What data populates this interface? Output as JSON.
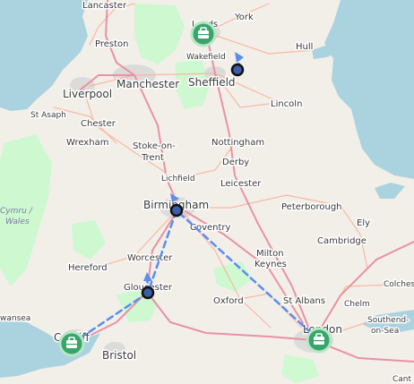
{
  "map": {
    "colors": {
      "sea": "#aad3df",
      "land": "#f2efe9",
      "road_major": "#e892a2",
      "road_primary": "#f9b29c",
      "park": "#c8facc",
      "urban": "#dddddd",
      "route": "#5b8def",
      "hub_fill": "#3aa56b",
      "stop_fill": "#3b5ea8"
    },
    "places": [
      {
        "name": "Lancaster",
        "size": "md"
      },
      {
        "name": "Leeds",
        "size": "md"
      },
      {
        "name": "York",
        "size": "md"
      },
      {
        "name": "Preston",
        "size": "md"
      },
      {
        "name": "Wakefield",
        "size": "sm"
      },
      {
        "name": "Hull",
        "size": "md"
      },
      {
        "name": "Liverpool",
        "size": "lg"
      },
      {
        "name": "Manchester",
        "size": "lg"
      },
      {
        "name": "Sheffield",
        "size": "lg"
      },
      {
        "name": "St Asaph",
        "size": "sm"
      },
      {
        "name": "Chester",
        "size": "md"
      },
      {
        "name": "Lincoln",
        "size": "md"
      },
      {
        "name": "Wrexham",
        "size": "md"
      },
      {
        "name": "Stoke-on-",
        "size": "md"
      },
      {
        "name": "Trent",
        "size": "md"
      },
      {
        "name": "Nottingham",
        "size": "md"
      },
      {
        "name": "Lichfield",
        "size": "sm"
      },
      {
        "name": "Derby",
        "size": "md"
      },
      {
        "name": "Leicester",
        "size": "md"
      },
      {
        "name": "Birmingham",
        "size": "lg"
      },
      {
        "name": "Peterborough",
        "size": "md"
      },
      {
        "name": "Coventry",
        "size": "md"
      },
      {
        "name": "Ely",
        "size": "md"
      },
      {
        "name": "Cambridge",
        "size": "md"
      },
      {
        "name": "Milton",
        "size": "md"
      },
      {
        "name": "Keynes",
        "size": "md"
      },
      {
        "name": "Hereford",
        "size": "md"
      },
      {
        "name": "Worcester",
        "size": "md"
      },
      {
        "name": "Colches",
        "size": "sm"
      },
      {
        "name": "Gloucester",
        "size": "md"
      },
      {
        "name": "Oxford",
        "size": "md"
      },
      {
        "name": "St Albans",
        "size": "md"
      },
      {
        "name": "Chelm",
        "size": "sm"
      },
      {
        "name": "Southend-",
        "size": "sm"
      },
      {
        "name": "on-Sea",
        "size": "sm"
      },
      {
        "name": "wansea",
        "size": "sm"
      },
      {
        "name": "Cardiff",
        "size": "lg"
      },
      {
        "name": "London",
        "size": "lg"
      },
      {
        "name": "Bristol",
        "size": "lg"
      },
      {
        "name": "Cant",
        "size": "sm"
      }
    ],
    "regions": [
      "Cymru /",
      "Wales"
    ],
    "markers": {
      "hubs": [
        {
          "city": "Leeds",
          "icon": "briefcase-icon"
        },
        {
          "city": "Cardiff",
          "icon": "briefcase-icon"
        },
        {
          "city": "London",
          "icon": "briefcase-icon"
        }
      ],
      "stops": [
        {
          "city": "Sheffield"
        },
        {
          "city": "Birmingham"
        },
        {
          "city": "Gloucester"
        }
      ]
    },
    "route": {
      "style": "dashed",
      "sequence": [
        "London",
        "Birmingham",
        "Gloucester",
        "Cardiff",
        "Sheffield"
      ]
    }
  }
}
